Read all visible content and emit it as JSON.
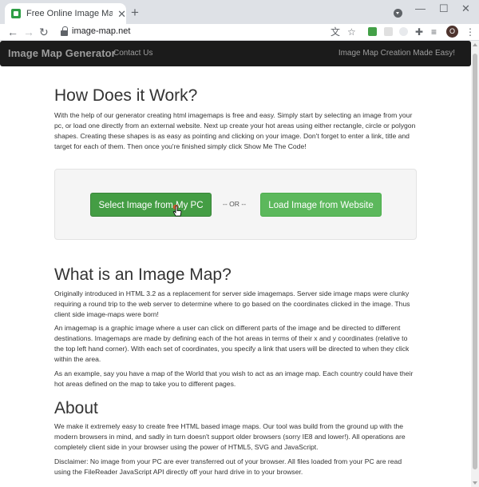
{
  "browser": {
    "tab_title": "Free Online Image Map Generator",
    "tab_close": "✕",
    "new_tab": "+",
    "url": "image-map.net",
    "avatar_initial": "O",
    "window_min": "—",
    "window_max": "☐",
    "window_close": "✕",
    "accent": "#2e9e45"
  },
  "navbar": {
    "brand": "Image Map Generator",
    "link_contact": "Contact Us",
    "tagline": "Image Map Creation Made Easy!"
  },
  "how": {
    "heading": "How Does it Work?",
    "body": "With the help of our generator creating html imagemaps is free and easy. Simply start by selecting an image from your pc, or load one directly from an external website. Next up create your hot areas using either rectangle, circle or polygon shapes. Creating these shapes is as easy as pointing and clicking on your image. Don't forget to enter a link, title and target for each of them. Then once you're finished simply click Show Me The Code!"
  },
  "actions": {
    "select_pc": "Select Image from My PC",
    "or": "-- OR --",
    "load_web": "Load Image from Website"
  },
  "what": {
    "heading": "What is an Image Map?",
    "p1": "Originally introduced in HTML 3.2 as a replacement for server side imagemaps. Server side image maps were clunky requiring a round trip to the web server to determine where to go based on the coordinates clicked in the image. Thus client side image-maps were born!",
    "p2": "An imagemap is a graphic image where a user can click on different parts of the image and be directed to different destinations. Imagemaps are made by defining each of the hot areas in terms of their x and y coordinates (relative to the top left hand corner). With each set of coordinates, you specify a link that users will be directed to when they click within the area.",
    "p3": "As an example, say you have a map of the World that you wish to act as an image map. Each country could have their hot areas defined on the map to take you to different pages."
  },
  "about": {
    "heading": "About",
    "p1": "We make it extremely easy to create free HTML based image maps. Our tool was build from the ground up with the modern browsers in mind, and sadly in turn doesn't support older browsers (sorry IE8 and lower!). All operations are completely client side in your browser using the power of HTML5, SVG and JavaScript.",
    "p2": "Disclaimer: No image from your PC are ever transferred out of your browser. All files loaded from your PC are read using the FileReader JavaScript API directly off your hard drive in to your browser."
  }
}
